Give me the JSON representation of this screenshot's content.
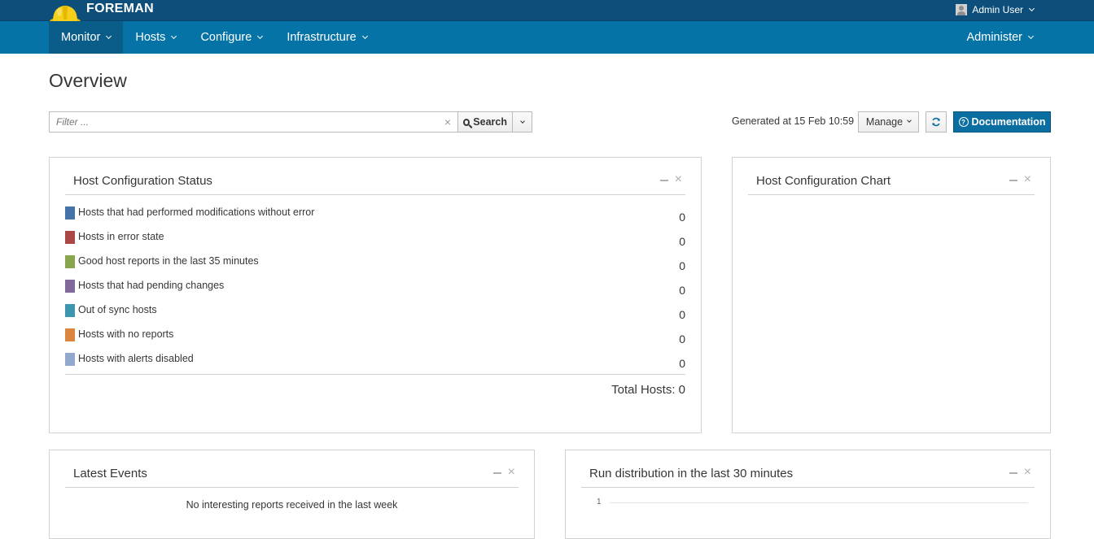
{
  "brand": {
    "name": "FOREMAN"
  },
  "user_menu": {
    "label": "Admin User"
  },
  "nav": {
    "items": [
      {
        "label": "Monitor",
        "active": true
      },
      {
        "label": "Hosts"
      },
      {
        "label": "Configure"
      },
      {
        "label": "Infrastructure"
      }
    ],
    "right": {
      "label": "Administer"
    }
  },
  "page": {
    "title": "Overview"
  },
  "toolbar": {
    "filter_placeholder": "Filter ...",
    "search_label": "Search",
    "generated": "Generated at 15 Feb 10:59",
    "manage_label": "Manage",
    "documentation_label": "Documentation"
  },
  "host_config_status": {
    "title": "Host Configuration Status",
    "rows": [
      {
        "label": "Hosts that had performed modifications without error",
        "value": "0",
        "color": "#4572a7"
      },
      {
        "label": "Hosts in error state",
        "value": "0",
        "color": "#aa4643"
      },
      {
        "label": "Good host reports in the last 35 minutes",
        "value": "0",
        "color": "#89a54e"
      },
      {
        "label": "Hosts that had pending changes",
        "value": "0",
        "color": "#80699b"
      },
      {
        "label": "Out of sync hosts",
        "value": "0",
        "color": "#3d96ae"
      },
      {
        "label": "Hosts with no reports",
        "value": "0",
        "color": "#db843d"
      },
      {
        "label": "Hosts with alerts disabled",
        "value": "0",
        "color": "#92a8cd"
      }
    ],
    "total": "Total Hosts: 0"
  },
  "host_config_chart": {
    "title": "Host Configuration Chart"
  },
  "latest_events": {
    "title": "Latest Events",
    "empty_message": "No interesting reports received in the last week"
  },
  "run_distribution": {
    "title": "Run distribution in the last 30 minutes",
    "y_tick": "1"
  }
}
